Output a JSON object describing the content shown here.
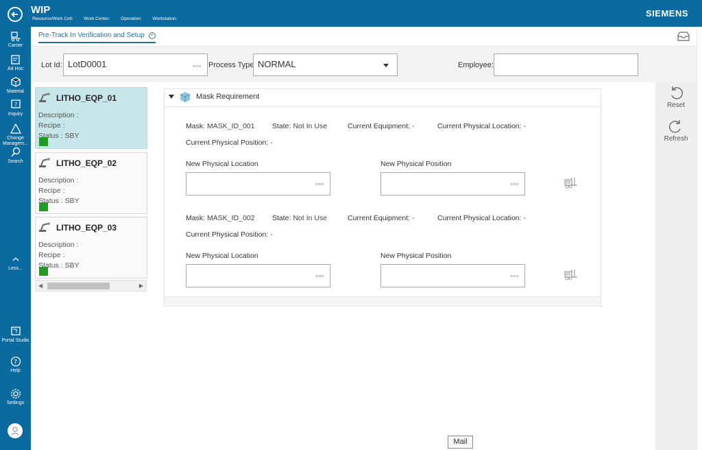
{
  "header": {
    "app_title": "WIP",
    "context": {
      "resource": "Resource/Work Cell:",
      "work_center": "Work Center:",
      "operation": "Operation:",
      "workstation": "Workstation:"
    },
    "brand": "SIEMENS"
  },
  "sidebar": {
    "items": [
      {
        "label": "Carrier",
        "icon": "carrier-icon"
      },
      {
        "label": "Ad Hoc",
        "icon": "ad-hoc-icon"
      },
      {
        "label": "Material",
        "icon": "material-icon"
      },
      {
        "label": "Inquiry",
        "icon": "inquiry-icon"
      },
      {
        "label": "Change Managem...",
        "icon": "change-management-icon"
      },
      {
        "label": "Search",
        "icon": "search-icon"
      }
    ],
    "less_label": "Less...",
    "bottom_items": [
      {
        "label": "Portal Studio",
        "icon": "portal-studio-icon"
      },
      {
        "label": "Help",
        "icon": "help-icon"
      },
      {
        "label": "Settings",
        "icon": "settings-icon"
      }
    ]
  },
  "tab": {
    "label": "Pre-Track In Verification and Setup",
    "close": "×"
  },
  "filters": {
    "lot_label": "Lot Id:",
    "lot_value": "LotD0001",
    "process_label": "Process Type:",
    "process_value": "NORMAL",
    "employee_label": "Employee:",
    "employee_value": "",
    "dots": "▫▫▫"
  },
  "equipment": [
    {
      "name": "LITHO_EQP_01",
      "description": "Description :",
      "recipe": "Recipe :",
      "status": "Status : SBY",
      "status_color": "#1e9d1e",
      "selected": true
    },
    {
      "name": "LITHO_EQP_02",
      "description": "Description :",
      "recipe": "Recipe :",
      "status": "Status : SBY",
      "status_color": "#1e9d1e",
      "selected": false
    },
    {
      "name": "LITHO_EQP_03",
      "description": "Description :",
      "recipe": "Recipe :",
      "status": "Status : SBY",
      "status_color": "#1e9d1e",
      "selected": false
    }
  ],
  "mask_panel": {
    "title": "Mask Requirement",
    "masks": [
      {
        "mask_label": "Mask:",
        "mask_value": "MASK_ID_001",
        "state_label": "State:",
        "state_value": "Not In Use",
        "equip_label": "Current Equipment:",
        "equip_value": "-",
        "loc_label": "Current Physical Location:",
        "loc_value": "-",
        "pos_label": "Current Physical Position:",
        "pos_value": "-",
        "new_loc_label": "New Physical Location",
        "new_pos_label": "New Physical Position"
      },
      {
        "mask_label": "Mask:",
        "mask_value": "MASK_ID_002",
        "state_label": "State:",
        "state_value": "Not In Use",
        "equip_label": "Current Equipment:",
        "equip_value": "-",
        "loc_label": "Current Physical Location:",
        "loc_value": "-",
        "pos_label": "Current Physical Position:",
        "pos_value": "-",
        "new_loc_label": "New Physical Location",
        "new_pos_label": "New Physical Position"
      }
    ]
  },
  "actions": {
    "reset": "Reset",
    "refresh": "Refresh"
  },
  "tooltip": "Mail",
  "colors": {
    "brand_blue": "#0b6aa0",
    "link_blue": "#1f6fa5",
    "selected_card": "#c6e6ea",
    "status_green": "#1e9d1e"
  }
}
